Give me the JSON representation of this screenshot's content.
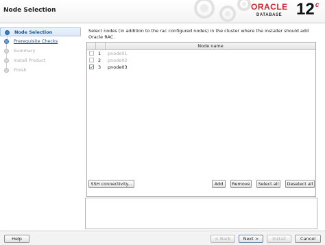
{
  "header": {
    "title": "Node Selection",
    "logo": {
      "brand": "ORACLE",
      "product": "DATABASE",
      "version": "12",
      "version_suffix": "c"
    }
  },
  "steps": [
    {
      "label": "Node Selection",
      "state": "current"
    },
    {
      "label": "Prerequisite Checks",
      "state": "link"
    },
    {
      "label": "Summary",
      "state": "disabled"
    },
    {
      "label": "Install Product",
      "state": "disabled"
    },
    {
      "label": "Finish",
      "state": "disabled"
    }
  ],
  "content": {
    "description": "Select nodes (in addition to the rac configured nodes) in the cluster where the installer should add Oracle RAC.",
    "table": {
      "header": "Node name",
      "rows": [
        {
          "num": "1",
          "name": "pnode01",
          "checked": false,
          "enabled": false
        },
        {
          "num": "2",
          "name": "pnode02",
          "checked": false,
          "enabled": false
        },
        {
          "num": "3",
          "name": "pnode03",
          "checked": true,
          "enabled": true
        }
      ]
    },
    "buttons": {
      "ssh": "SSH connectivity...",
      "add": "Add",
      "remove": "Remove",
      "select_all": "Select all",
      "deselect_all": "Deselect all"
    }
  },
  "footer": {
    "help": "Help",
    "back": "< Back",
    "next": "Next >",
    "install": "Install",
    "cancel": "Cancel"
  },
  "colors": {
    "accent": "#3b7cc4",
    "oracle_red": "#d2232a"
  }
}
